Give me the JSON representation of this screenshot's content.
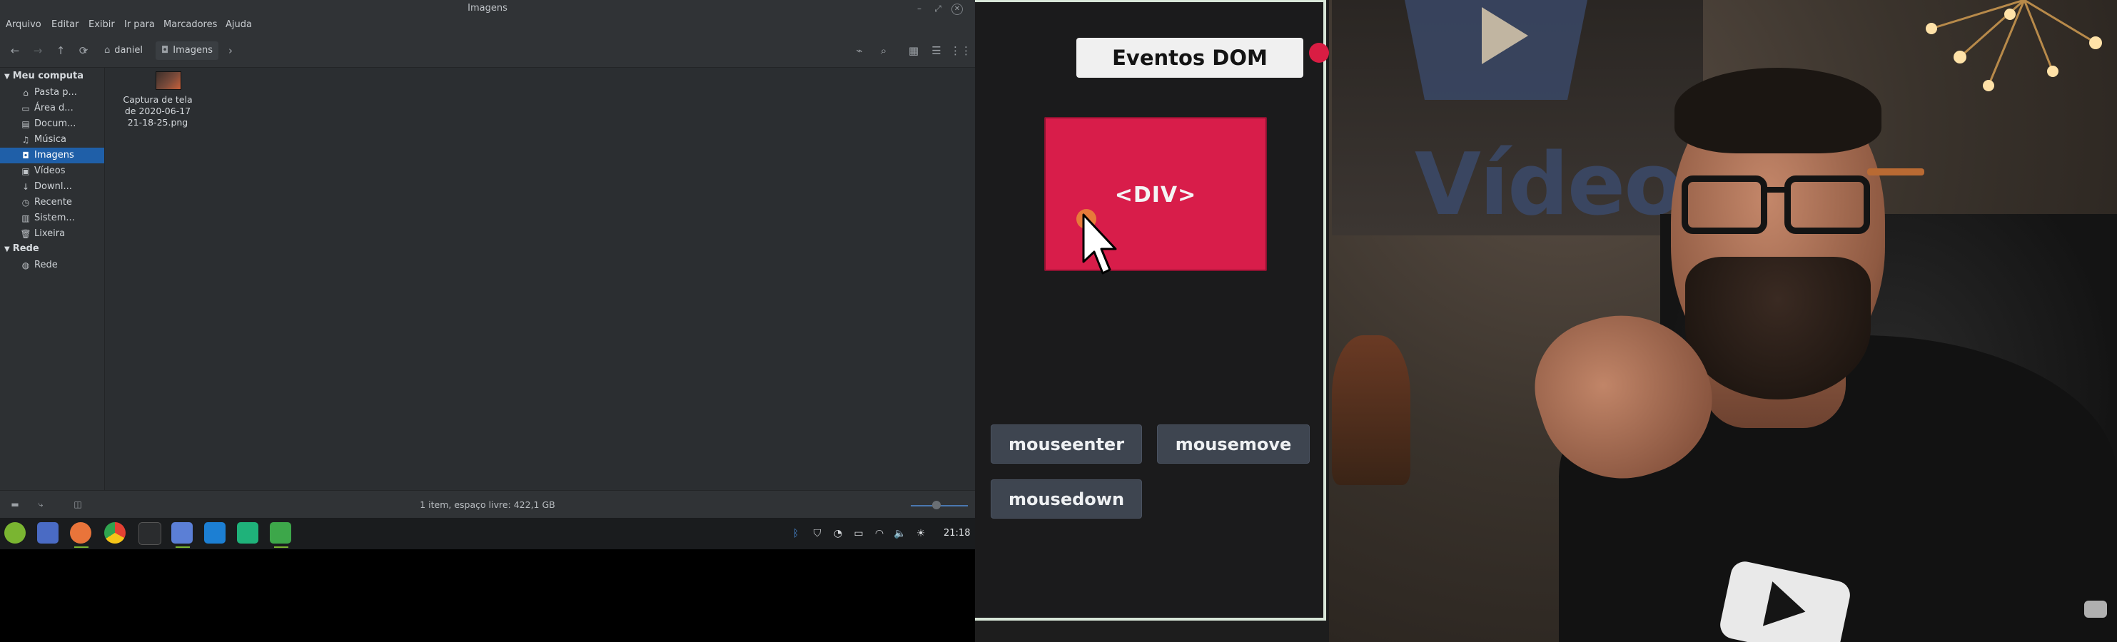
{
  "window": {
    "title": "Imagens",
    "controls": [
      "minimize-icon",
      "maximize-icon",
      "close-icon"
    ]
  },
  "menubar": [
    "Arquivo",
    "Editar",
    "Exibir",
    "Ir para",
    "Marcadores",
    "Ajuda"
  ],
  "toolbar": {
    "breadcrumbs": [
      {
        "label": "daniel",
        "icon": "home-icon"
      },
      {
        "label": "Imagens",
        "icon": "camera-icon"
      }
    ]
  },
  "sidebar": {
    "sections": [
      {
        "title": "Meu computa",
        "items": [
          {
            "label": "Pasta p...",
            "icon": "home-icon"
          },
          {
            "label": "Área d...",
            "icon": "desktop-icon"
          },
          {
            "label": "Docum...",
            "icon": "document-icon"
          },
          {
            "label": "Música",
            "icon": "music-icon"
          },
          {
            "label": "Imagens",
            "icon": "camera-icon",
            "active": true
          },
          {
            "label": "Vídeos",
            "icon": "video-icon"
          },
          {
            "label": "Downl...",
            "icon": "download-icon"
          },
          {
            "label": "Recente",
            "icon": "clock-icon"
          },
          {
            "label": "Sistem...",
            "icon": "drive-icon"
          },
          {
            "label": "Lixeira",
            "icon": "trash-icon"
          }
        ]
      },
      {
        "title": "Rede",
        "items": [
          {
            "label": "Rede",
            "icon": "network-icon"
          }
        ]
      }
    ]
  },
  "files": [
    {
      "name_line1": "Captura de tela",
      "name_line2": "de 2020-06-17",
      "name_line3": "21-18-25.png"
    }
  ],
  "statusbar": {
    "text": "1 item, espaço livre: 422,1 GB"
  },
  "taskbar": {
    "apps": [
      "mint-menu-icon",
      "desktop-icon",
      "firefox-icon",
      "chrome-icon",
      "terminal-icon",
      "files-icon",
      "vscode-icon",
      "pycharm-icon",
      "screenshot-icon"
    ],
    "tray": [
      "bluetooth-icon",
      "shield-icon",
      "update-icon",
      "battery-icon",
      "wifi-icon",
      "volume-icon",
      "brightness-icon"
    ],
    "clock": "21:18"
  },
  "slide": {
    "title": "Eventos DOM",
    "box_label": "<DIV>",
    "events": [
      "mouseenter",
      "mousemove",
      "mousedown"
    ]
  },
  "video": {
    "background_text": "Vídeo"
  },
  "colors": {
    "accent_selection": "#1f5fa8",
    "slide_box": "#d81d4a",
    "event_button": "#3e4550"
  }
}
